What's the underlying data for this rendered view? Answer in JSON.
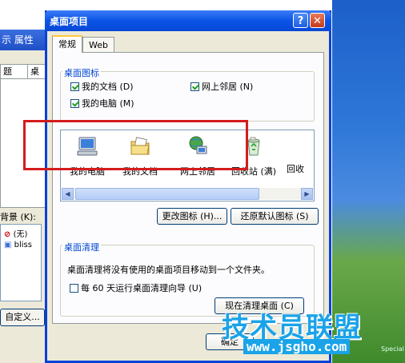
{
  "background_window": {
    "title_fragment": "示 属性",
    "tab1": "题",
    "tab2": "桌",
    "background_label": "背景 (K):",
    "list_items": [
      "(无)",
      "bliss"
    ],
    "custom_button": "自定义..."
  },
  "dialog": {
    "title": "桌面项目",
    "help_glyph": "?",
    "close_glyph": "✕",
    "tabs": [
      {
        "label": "常规",
        "active": true
      },
      {
        "label": "Web",
        "active": false
      }
    ],
    "desktop_icons_group": {
      "title": "桌面图标",
      "checkboxes": [
        {
          "label": "我的文档 (D)",
          "checked": true
        },
        {
          "label": "网上邻居 (N)",
          "checked": true
        },
        {
          "label": "我的电脑 (M)",
          "checked": true
        }
      ]
    },
    "icon_view": {
      "items": [
        {
          "label": "我的电脑",
          "icon": "my-computer-icon"
        },
        {
          "label": "我的文档",
          "icon": "my-documents-icon"
        },
        {
          "label": "网上邻居",
          "icon": "network-places-icon"
        },
        {
          "label": "回收站 (满)",
          "icon": "recycle-bin-full-icon"
        },
        {
          "label": "回收",
          "icon": "recycle-bin-empty-icon"
        }
      ]
    },
    "change_icon_button": "更改图标 (H)...",
    "restore_default_button": "还原默认图标 (S)",
    "cleanup_group": {
      "title": "桌面清理",
      "description": "桌面清理将没有使用的桌面项目移动到一个文件夹。",
      "checkbox_label": "每 60 天运行桌面清理向导 (U)",
      "checkbox_checked": false,
      "cleanup_now_button": "现在清理桌面 (C)"
    },
    "ok_button_fragment": "确定"
  },
  "desktop_fragment": "Special",
  "watermark": {
    "text": "技术员联盟",
    "url": "www.jsgho.com"
  },
  "colors": {
    "title_bar": "#0a54e6",
    "dialog_bg": "#ece9d8",
    "group_title": "#0046d5",
    "highlight_box": "#d41c1c",
    "watermark": "#1aa3e8"
  }
}
